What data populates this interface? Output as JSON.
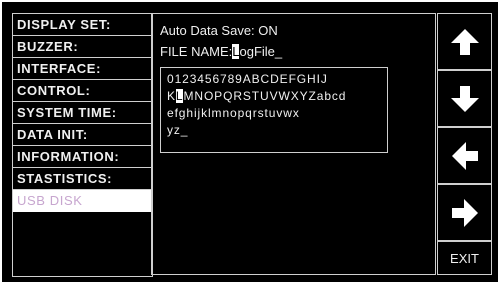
{
  "menu": {
    "items": [
      {
        "label": "DISPLAY SET:"
      },
      {
        "label": "BUZZER:"
      },
      {
        "label": "INTERFACE:"
      },
      {
        "label": "CONTROL:"
      },
      {
        "label": "SYSTEM TIME:"
      },
      {
        "label": "DATA INIT:"
      },
      {
        "label": "INFORMATION:"
      },
      {
        "label": "STASTISTICS:"
      },
      {
        "label": "USB DISK",
        "selected": true
      }
    ]
  },
  "panel": {
    "auto_save_label": "Auto Data Save:",
    "auto_save_value": "ON",
    "file_name_label": "FILE NAME:",
    "file_name_cursor_char": "L",
    "file_name_rest": "ogFile_",
    "char_grid": {
      "row1": "0123456789ABCDEFGHIJ",
      "row2_before": "K",
      "row2_selected": "L",
      "row2_after": "MNOPQRSTUVWXYZabcd",
      "row3": "efghijklmnopqrstuvwx",
      "row4": "yz_"
    }
  },
  "nav": {
    "up_icon": "arrow-up-icon",
    "down_icon": "arrow-down-icon",
    "left_icon": "arrow-left-icon",
    "right_icon": "arrow-right-icon",
    "exit_label": "EXIT"
  },
  "colors": {
    "background": "#000000",
    "text": "#f0f0f0",
    "selected_bg": "#ffffff",
    "selected_text": "#c7a6cf",
    "border": "#cfcfcf"
  }
}
